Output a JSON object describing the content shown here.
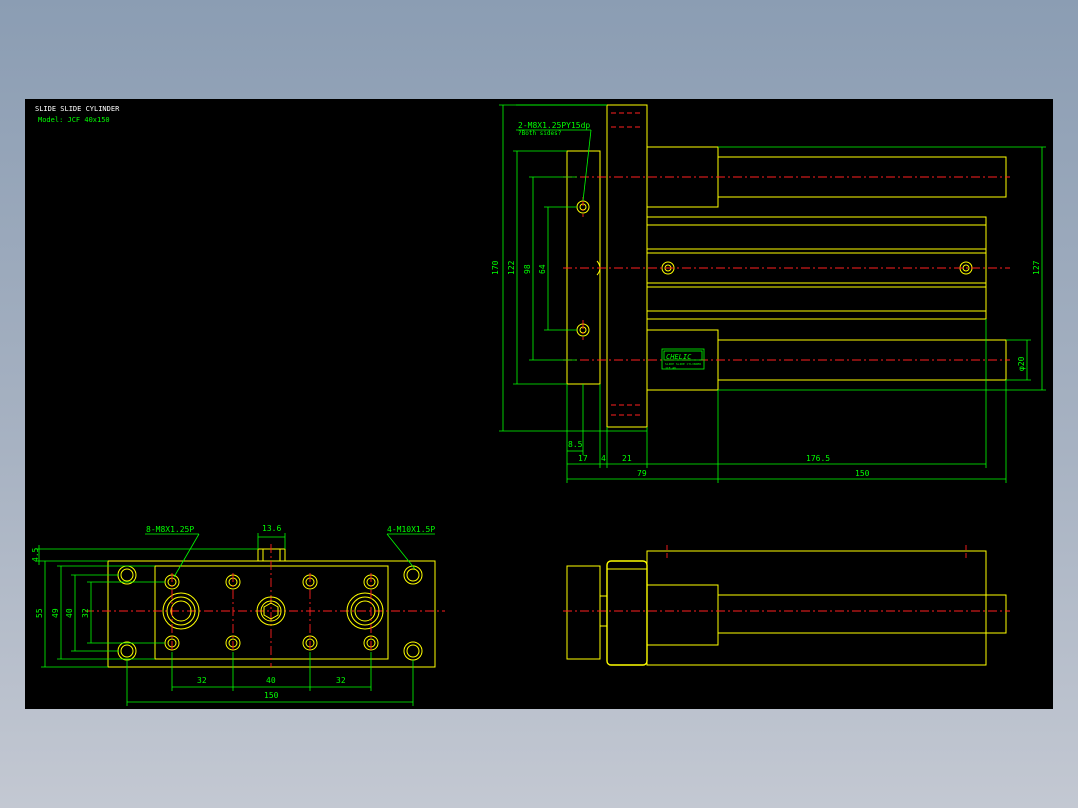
{
  "title": {
    "line1": "SLIDE SLIDE CYLINDER",
    "line2": "Model: JCF 40x150"
  },
  "colors": {
    "outline": "#ffff00",
    "dimension": "#00ff00",
    "centerline": "#ff2020",
    "background": "#000000"
  },
  "notes": {
    "top_tapped": "2-M8X1.25PY15dp",
    "top_tapped_sub": "?Both sides?",
    "front_tapped_1": "8-M8X1.25P",
    "front_tapped_2": "4-M10X1.5P",
    "logo": "CHELIC",
    "logo_sub1": "SLIDE SLIDE CYLINDER",
    "logo_sub2": "JCF 40"
  },
  "dimensions": {
    "d170": "170",
    "d122": "122",
    "d98": "98",
    "d64": "64",
    "d127": "127",
    "d20": "φ20",
    "d8_5": "8.5",
    "d17": "17",
    "d4": "4",
    "d21": "21",
    "d176_5": "176.5",
    "d79": "79",
    "d150_side": "150",
    "d13_6": "13.6",
    "d4_5": "4.5",
    "d55": "55",
    "d49": "49",
    "d40_v": "40",
    "d32_v": "32",
    "d32_h1": "32",
    "d40_h": "40",
    "d32_h2": "32",
    "d150_front": "150"
  }
}
